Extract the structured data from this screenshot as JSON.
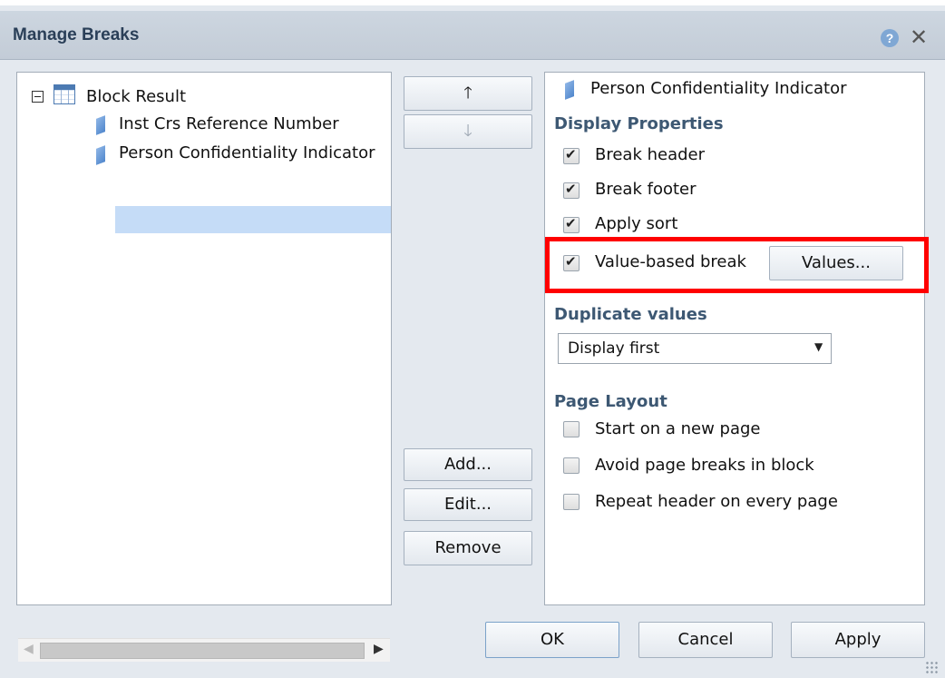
{
  "dialog": {
    "title": "Manage Breaks",
    "help_icon": "?",
    "close_icon": "✕"
  },
  "tree": {
    "root_label": "Block Result",
    "items": [
      {
        "label": "Inst Crs Reference Number"
      },
      {
        "label": "Person Confidentiality Indicator",
        "selected": true
      }
    ]
  },
  "middle_buttons": {
    "move_up": "🡑",
    "move_down": "🡓",
    "add": "Add...",
    "edit": "Edit...",
    "remove": "Remove"
  },
  "properties": {
    "object_name": "Person Confidentiality Indicator",
    "display_section": "Display Properties",
    "display_options": [
      {
        "label": "Break header",
        "checked": true
      },
      {
        "label": "Break footer",
        "checked": true
      },
      {
        "label": "Apply sort",
        "checked": true
      },
      {
        "label": "Value-based break",
        "checked": true
      }
    ],
    "values_button": "Values...",
    "duplicate_section": "Duplicate values",
    "duplicate_selected": "Display first",
    "layout_section": "Page Layout",
    "layout_options": [
      {
        "label": "Start on a new page",
        "checked": false
      },
      {
        "label": "Avoid page breaks in block",
        "checked": false
      },
      {
        "label": "Repeat header on every page",
        "checked": false
      }
    ]
  },
  "footer_buttons": {
    "ok": "OK",
    "cancel": "Cancel",
    "apply": "Apply"
  },
  "colors": {
    "highlight": "#ff0000",
    "selection": "#c5dcf7",
    "section_title": "#3d5873"
  }
}
